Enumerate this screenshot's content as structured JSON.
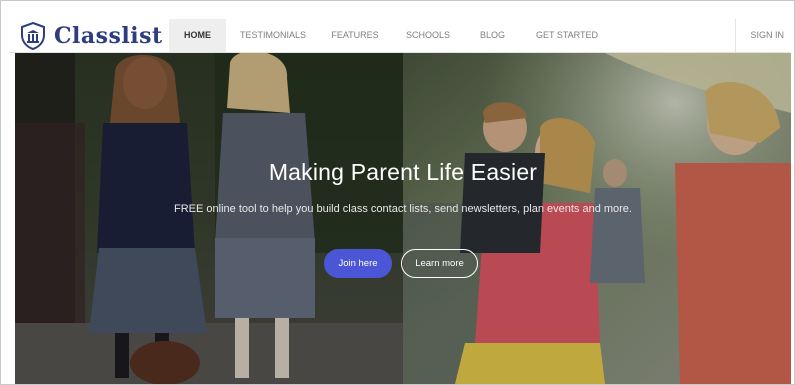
{
  "brand": {
    "name": "Classlist",
    "color": "#2e3d80"
  },
  "nav": {
    "items": [
      {
        "label": "HOME",
        "active": true
      },
      {
        "label": "TESTIMONIALS",
        "active": false
      },
      {
        "label": "FEATURES",
        "active": false
      },
      {
        "label": "SCHOOLS",
        "active": false
      },
      {
        "label": "BLOG",
        "active": false
      },
      {
        "label": "GET STARTED",
        "active": false
      }
    ],
    "signin": "SIGN IN"
  },
  "hero": {
    "title": "Making Parent Life Easier",
    "subtitle": "FREE online tool to help you build class contact lists, send newsletters, plan events and more.",
    "join_label": "Join here",
    "learn_label": "Learn more"
  },
  "colors": {
    "accent": "#4b56d6",
    "nav_active_bg": "#eeeeee"
  },
  "icons": {
    "logo": "school-shield-icon"
  }
}
